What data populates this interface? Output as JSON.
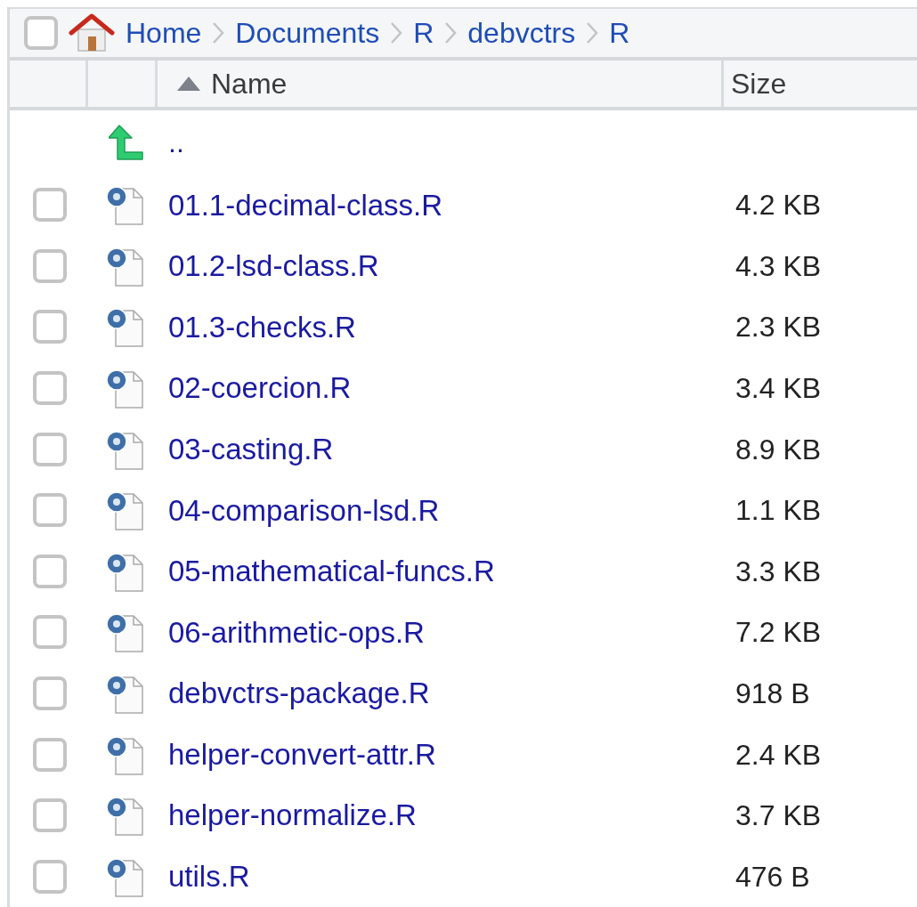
{
  "breadcrumb": {
    "select_all_checked": false,
    "items": [
      "Home",
      "Documents",
      "R",
      "debvctrs",
      "R"
    ]
  },
  "columns": [
    {
      "label": "Name",
      "sorted": true
    },
    {
      "label": "Size",
      "sorted": false
    }
  ],
  "parent_row": {
    "label": ".."
  },
  "files": [
    {
      "name": "01.1-decimal-class.R",
      "size": "4.2 KB",
      "checked": false
    },
    {
      "name": "01.2-lsd-class.R",
      "size": "4.3 KB",
      "checked": false
    },
    {
      "name": "01.3-checks.R",
      "size": "2.3 KB",
      "checked": false
    },
    {
      "name": "02-coercion.R",
      "size": "3.4 KB",
      "checked": false
    },
    {
      "name": "03-casting.R",
      "size": "8.9 KB",
      "checked": false
    },
    {
      "name": "04-comparison-lsd.R",
      "size": "1.1 KB",
      "checked": false
    },
    {
      "name": "05-mathematical-funcs.R",
      "size": "3.3 KB",
      "checked": false
    },
    {
      "name": "06-arithmetic-ops.R",
      "size": "7.2 KB",
      "checked": false
    },
    {
      "name": "debvctrs-package.R",
      "size": "918 B",
      "checked": false
    },
    {
      "name": "helper-convert-attr.R",
      "size": "2.4 KB",
      "checked": false
    },
    {
      "name": "helper-normalize.R",
      "size": "3.7 KB",
      "checked": false
    },
    {
      "name": "utils.R",
      "size": "476 B",
      "checked": false
    }
  ]
}
